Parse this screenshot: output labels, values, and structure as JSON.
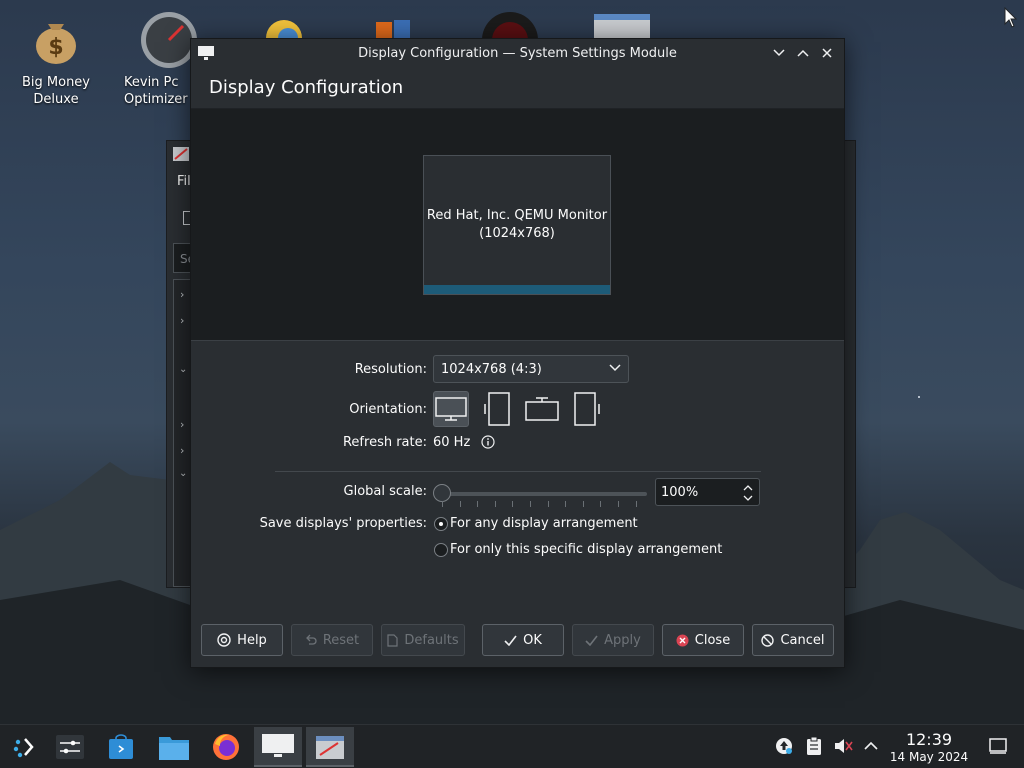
{
  "desktop": {
    "icons": [
      {
        "label": "Big Money\nDeluxe"
      },
      {
        "label": "Kevin Pc\nOptimizer"
      }
    ]
  },
  "bg_window": {
    "menu_label": "Fil",
    "search_placeholder": "Se"
  },
  "dialog": {
    "title": "Display Configuration — System Settings Module",
    "header": "Display Configuration",
    "monitor": {
      "name": "Red Hat, Inc. QEMU Monitor",
      "resolution": "(1024x768)"
    },
    "resolution_label": "Resolution:",
    "resolution_value": "1024x768 (4:3)",
    "orientation_label": "Orientation:",
    "refresh_label": "Refresh rate:",
    "refresh_value": "60 Hz",
    "global_scale_label": "Global scale:",
    "global_scale_value": "100%",
    "global_scale_level": 0,
    "save_label": "Save displays' properties:",
    "radio_any": "For any display arrangement",
    "radio_specific": "For only this specific display arrangement",
    "buttons": {
      "help": "Help",
      "reset": "Reset",
      "defaults": "Defaults",
      "ok": "OK",
      "apply": "Apply",
      "close": "Close",
      "cancel": "Cancel"
    }
  },
  "taskbar": {
    "time": "12:39",
    "date": "14 May 2024"
  }
}
